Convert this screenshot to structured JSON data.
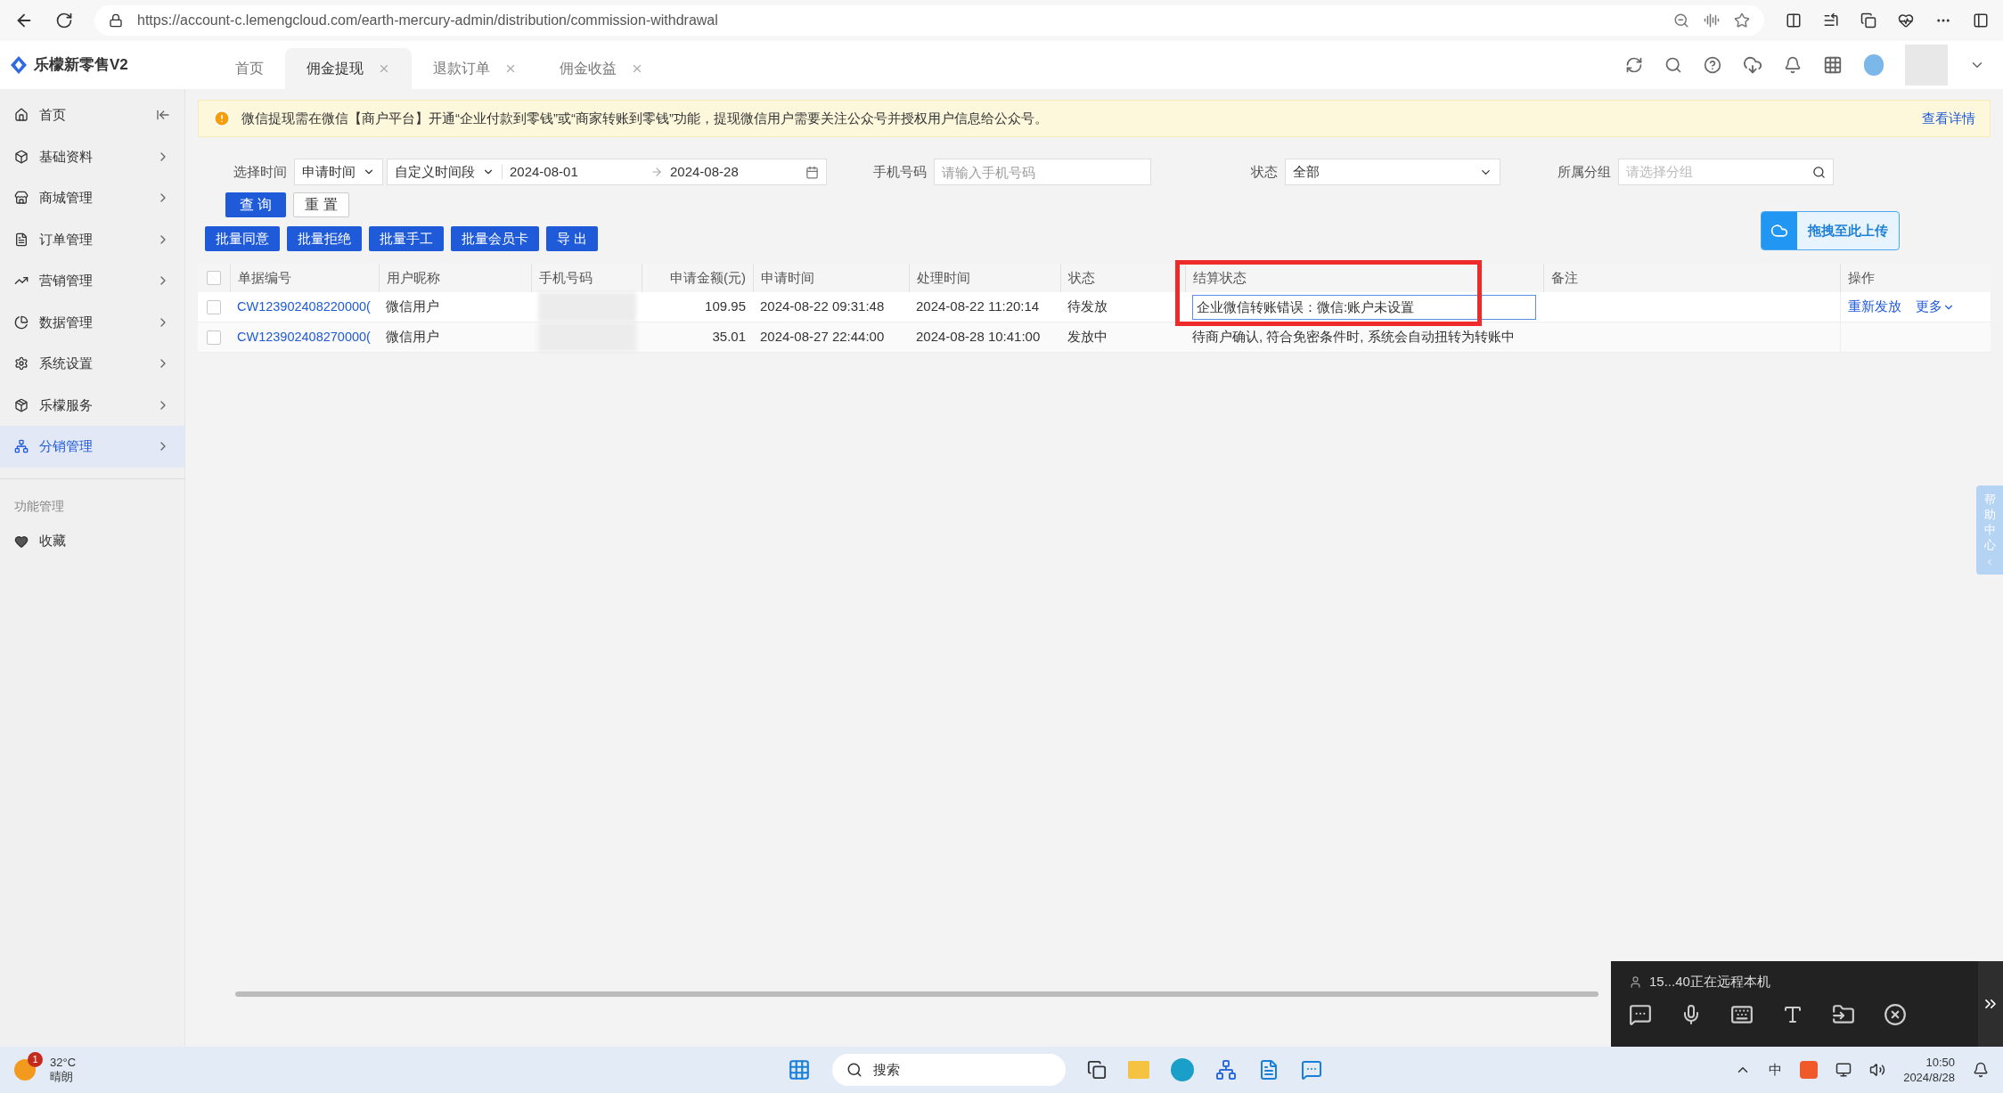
{
  "browser": {
    "url": "https://account-c.lemengcloud.com/earth-mercury-admin/distribution/commission-withdrawal"
  },
  "app": {
    "brand": "乐檬新零售V2",
    "tabs": [
      {
        "label": "首页",
        "selected": false,
        "closable": false
      },
      {
        "label": "佣金提现",
        "selected": true,
        "closable": true
      },
      {
        "label": "退款订单",
        "selected": false,
        "closable": true
      },
      {
        "label": "佣金收益",
        "selected": false,
        "closable": true
      }
    ]
  },
  "sidebar": {
    "items": [
      {
        "label": "首页",
        "selected": false,
        "kind": "collapse"
      },
      {
        "label": "基础资料",
        "selected": false,
        "kind": "menu"
      },
      {
        "label": "商城管理",
        "selected": false,
        "kind": "menu"
      },
      {
        "label": "订单管理",
        "selected": false,
        "kind": "menu"
      },
      {
        "label": "营销管理",
        "selected": false,
        "kind": "menu"
      },
      {
        "label": "数据管理",
        "selected": false,
        "kind": "menu"
      },
      {
        "label": "系统设置",
        "selected": false,
        "kind": "menu"
      },
      {
        "label": "乐檬服务",
        "selected": false,
        "kind": "menu"
      },
      {
        "label": "分销管理",
        "selected": true,
        "kind": "menu"
      }
    ],
    "section_title": "功能管理",
    "section_items": [
      {
        "label": "收藏",
        "selected": false
      }
    ]
  },
  "alert": {
    "text": "微信提现需在微信【商户平台】开通“企业付款到零钱”或“商家转账到零钱”功能，提现微信用户需要关注公众号并授权用户信息给公众号。",
    "link": "查看详情"
  },
  "filters": {
    "time_label": "选择时间",
    "time_type": "申请时间",
    "range_type": "自定义时间段",
    "start": "2024-08-01",
    "end": "2024-08-28",
    "phone_label": "手机号码",
    "phone_placeholder": "请输入手机号码",
    "status_label": "状态",
    "status_value": "全部",
    "group_label": "所属分组",
    "group_placeholder": "请选择分组",
    "query_button": "查 询",
    "reset_button": "重 置"
  },
  "batch_buttons": [
    "批量同意",
    "批量拒绝",
    "批量手工",
    "批量会员卡",
    "导 出"
  ],
  "upload_button": "拖拽至此上传",
  "table": {
    "all_checked": false,
    "columns": [
      {
        "label": "单据编号",
        "highlighted": false
      },
      {
        "label": "用户昵称",
        "highlighted": false
      },
      {
        "label": "手机号码",
        "highlighted": false
      },
      {
        "label": "申请金额(元)",
        "highlighted": false
      },
      {
        "label": "申请时间",
        "highlighted": false
      },
      {
        "label": "处理时间",
        "highlighted": false
      },
      {
        "label": "状态",
        "highlighted": false
      },
      {
        "label": "结算状态",
        "highlighted": true
      },
      {
        "label": "备注",
        "highlighted": false
      },
      {
        "label": "操作",
        "highlighted": false
      }
    ],
    "rows": [
      {
        "checked": false,
        "id": "CW123902408220000(",
        "nickname": "微信用户",
        "amount": "109.95",
        "applied": "2024-08-22 09:31:48",
        "processed": "2024-08-22 11:20:14",
        "status": "待发放",
        "settlement": "企业微信转账错误：微信:账户未设置",
        "settlement_editing": true,
        "actions": [
          "重新发放"
        ],
        "more": "更多"
      },
      {
        "checked": false,
        "id": "CW123902408270000(",
        "nickname": "微信用户",
        "amount": "35.01",
        "applied": "2024-08-27 22:44:00",
        "processed": "2024-08-28 10:41:00",
        "status": "发放中",
        "settlement": "待商户确认, 符合免密条件时, 系统会自动扭转为转账中",
        "settlement_editing": false,
        "actions": []
      }
    ]
  },
  "help_tab": "帮助中心",
  "remote": {
    "text": "15...40正在远程本机"
  },
  "taskbar": {
    "temp": "32°C",
    "weather": "晴朗",
    "badge": "1",
    "search": "搜索",
    "ime": "中",
    "time": "10:50",
    "date": "2024/8/28"
  }
}
